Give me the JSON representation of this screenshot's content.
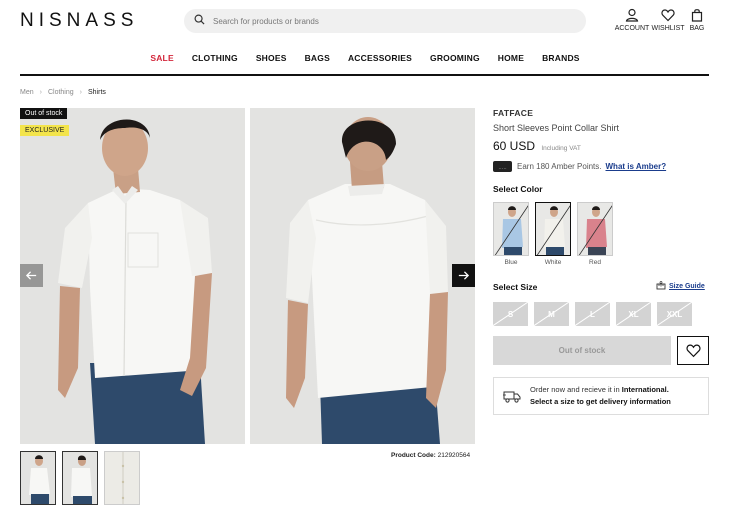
{
  "header": {
    "logo": "NISNASS",
    "search_placeholder": "Search for products or brands",
    "account_label": "ACCOUNT",
    "wishlist_label": "WISHLIST",
    "bag_label": "BAG"
  },
  "nav": [
    "SALE",
    "CLOTHING",
    "SHOES",
    "BAGS",
    "ACCESSORIES",
    "GROOMING",
    "HOME",
    "BRANDS"
  ],
  "breadcrumb": {
    "items": [
      "Men",
      "Clothing"
    ],
    "current": "Shirts"
  },
  "gallery": {
    "badge_stock": "Out of stock",
    "badge_exclusive": "EXCLUSIVE",
    "product_code_label": "Product Code:",
    "product_code": "212920564"
  },
  "product": {
    "brand": "FATFACE",
    "name": "Short Sleeves Point Collar Shirt",
    "price": "60 USD",
    "vat_note": "Including VAT",
    "amber_card_text": "·····",
    "amber_points": "Earn 180 Amber Points.",
    "amber_link": "What is Amber?"
  },
  "color": {
    "heading": "Select Color",
    "options": [
      "Blue",
      "White",
      "Red"
    ],
    "selected": "White",
    "swatch_colors": [
      "#a9c7e4",
      "#f2f1ec",
      "#d9828c"
    ]
  },
  "size": {
    "heading": "Select Size",
    "guide_label": "Size Guide",
    "options": [
      "S",
      "M",
      "L",
      "XL",
      "XXL"
    ]
  },
  "actions": {
    "oos_label": "Out of stock"
  },
  "delivery": {
    "line1_prefix": "Order now and recieve it in",
    "line1_bold": "International.",
    "line2": "Select a size to get delivery information"
  },
  "colors": {
    "sale_red": "#d3263a",
    "link_blue": "#1a3c8c",
    "badge_yellow": "#f3e44b"
  }
}
